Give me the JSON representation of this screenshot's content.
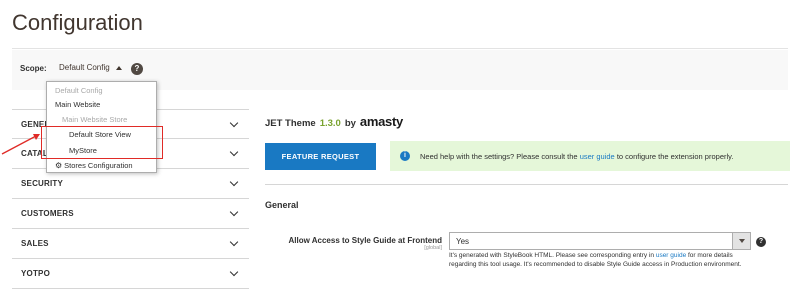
{
  "page": {
    "title": "Configuration"
  },
  "scope": {
    "label": "Scope:",
    "current": "Default Config",
    "help": "?"
  },
  "dropdown": {
    "items": [
      {
        "label": "Default Config",
        "state": "disabled"
      },
      {
        "label": "Main Website",
        "state": "active"
      },
      {
        "label": "Main Website Store",
        "state": "disabled"
      },
      {
        "label": "Default Store View",
        "state": "active"
      },
      {
        "label": "MyStore",
        "state": "active"
      },
      {
        "label": "Stores Configuration",
        "state": "active",
        "icon": "gear-icon"
      }
    ]
  },
  "sidebar": {
    "items": [
      {
        "label": "GENER"
      },
      {
        "label": "CATALO"
      },
      {
        "label": "SECURITY"
      },
      {
        "label": "CUSTOMERS"
      },
      {
        "label": "SALES"
      },
      {
        "label": "YOTPO"
      }
    ]
  },
  "extension": {
    "name": "JET Theme",
    "version": "1.3.0",
    "by": "by",
    "brand": "amasty"
  },
  "feature_button": {
    "label": "FEATURE REQUEST"
  },
  "notice": {
    "icon": "info-icon",
    "text_before": "Need help with the settings? Please consult the",
    "link": "user guide",
    "text_after": "to configure the extension properly."
  },
  "section": {
    "title": "General"
  },
  "field": {
    "label": "Allow Access to Style Guide at Frontend",
    "scope": "[global]",
    "value": "Yes",
    "note_before": "It's generated with StyleBook HTML. Please see corresponding entry in",
    "note_link": "user guide",
    "note_after": "for more details regarding this tool usage. It's recommended to disable Style Guide access in Production environment."
  },
  "colors": {
    "accent": "#1979c3",
    "highlight": "#e02b27",
    "notice_bg": "#e5f7d9",
    "version": "#79a22e"
  }
}
